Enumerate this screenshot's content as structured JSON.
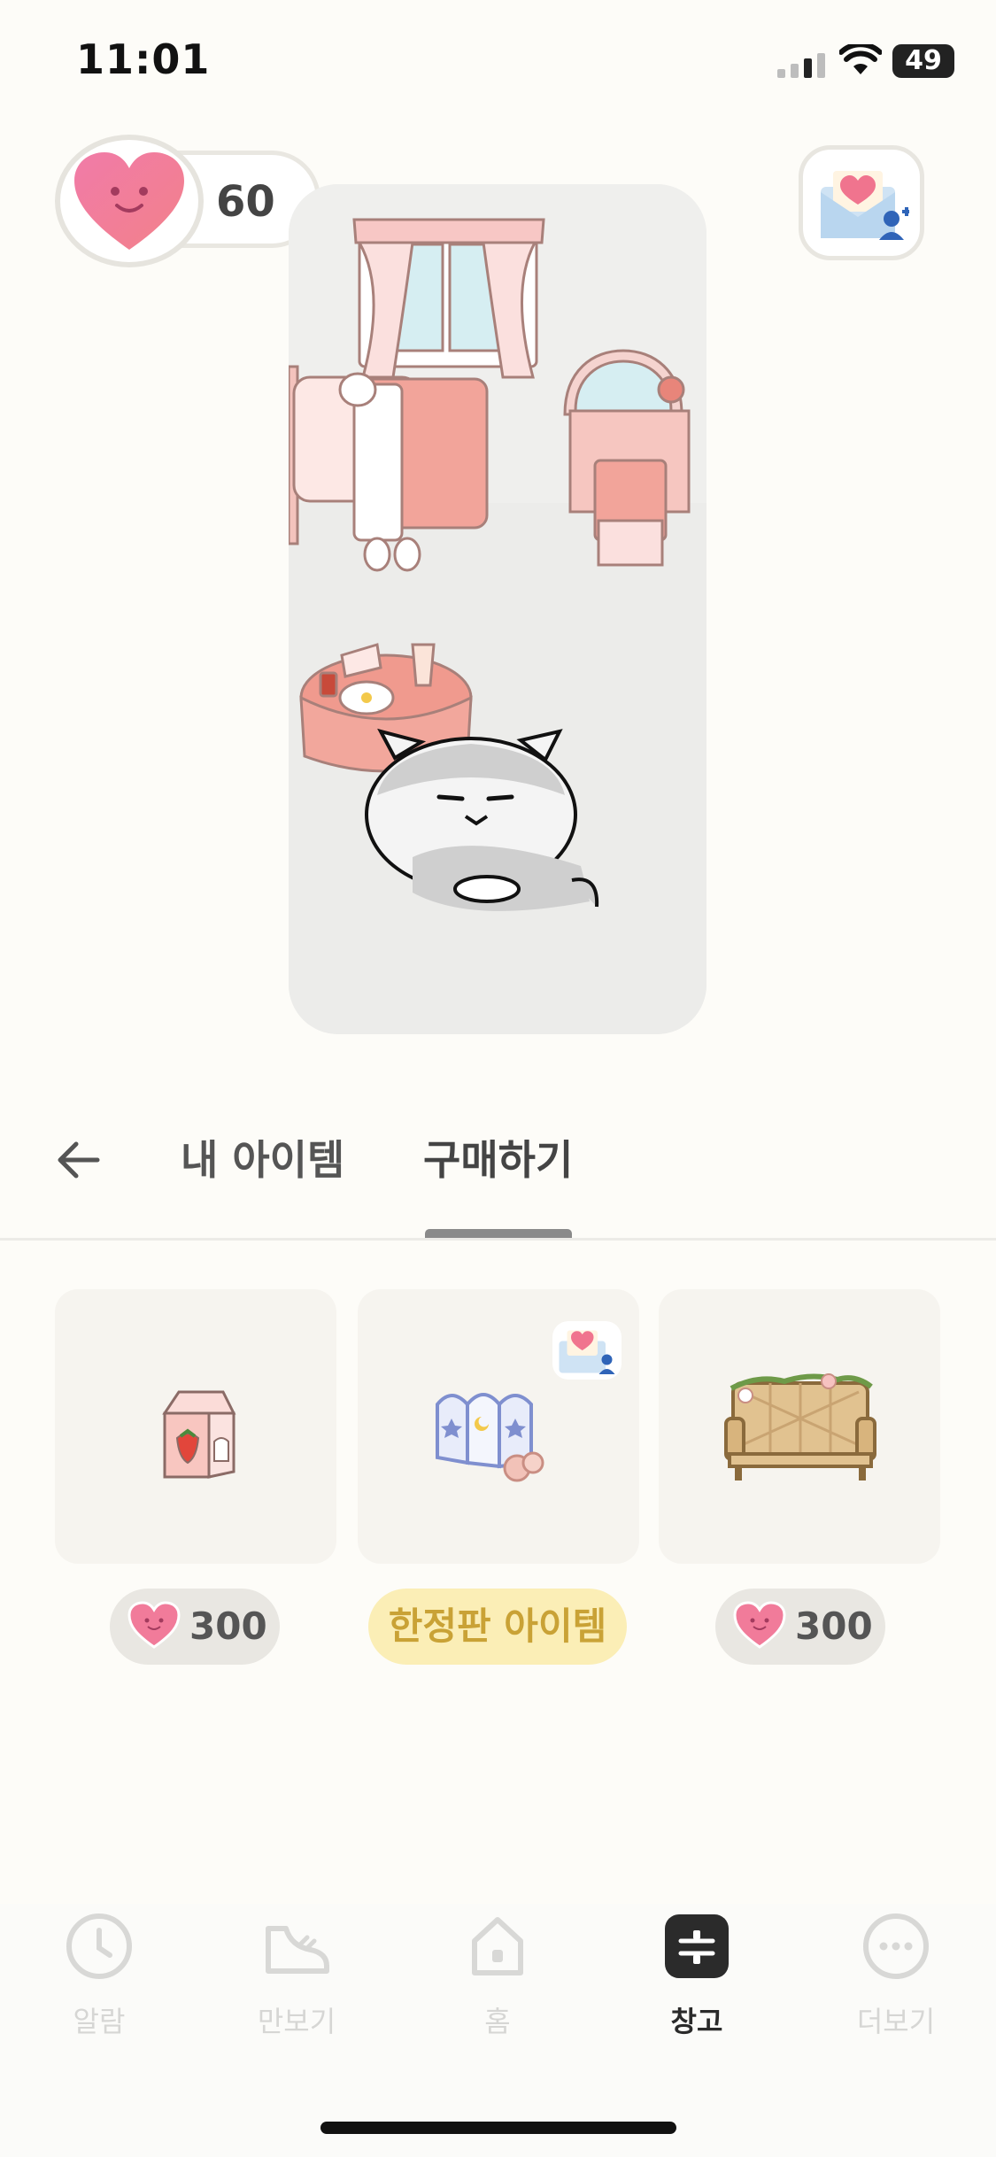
{
  "status_bar": {
    "time": "11:01",
    "battery": "49"
  },
  "header": {
    "heart_count": "60"
  },
  "tabs": {
    "my_items": "내 아이템",
    "buy": "구매하기"
  },
  "items": [
    {
      "name": "strawberry-milk",
      "price": "300"
    },
    {
      "name": "folding-screen",
      "price_label": "한정판 아이템"
    },
    {
      "name": "wicker-bench",
      "price": "300"
    }
  ],
  "nav": [
    {
      "label": "알람",
      "icon": "clock-icon"
    },
    {
      "label": "만보기",
      "icon": "sneaker-icon"
    },
    {
      "label": "홈",
      "icon": "house-icon"
    },
    {
      "label": "창고",
      "icon": "storage-icon",
      "active": true
    },
    {
      "label": "더보기",
      "icon": "more-icon"
    }
  ],
  "colors": {
    "accent": "#f08aa0",
    "limited_bg": "#fbeeb6",
    "limited_text": "#c9a236",
    "background": "#fdfcf8"
  }
}
